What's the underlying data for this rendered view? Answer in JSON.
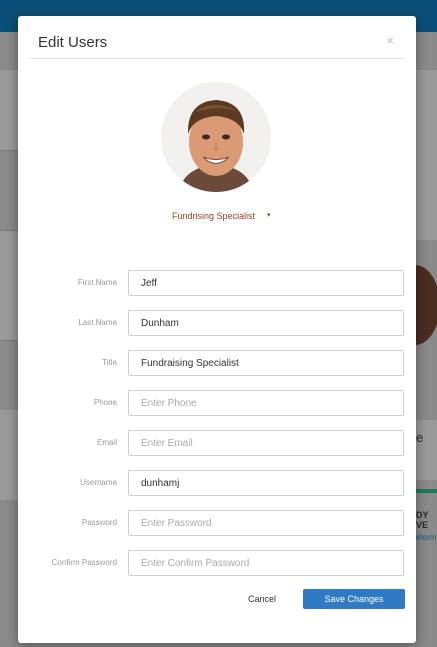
{
  "modal": {
    "title": "Edit Users",
    "close_label": "×",
    "role": {
      "selected": "Fundrising Specialist",
      "caret": "▾"
    }
  },
  "form": {
    "fields": [
      {
        "label": "First Name",
        "value": "Jeff",
        "placeholder": ""
      },
      {
        "label": "Last Name",
        "value": "Dunham",
        "placeholder": ""
      },
      {
        "label": "Title",
        "value": "Fundraising Specialist",
        "placeholder": ""
      },
      {
        "label": "Phone",
        "value": "",
        "placeholder": "Enter Phone"
      },
      {
        "label": "Email",
        "value": "",
        "placeholder": "Enter Email"
      },
      {
        "label": "Username",
        "value": "dunhamj",
        "placeholder": ""
      },
      {
        "label": "Password",
        "value": "",
        "placeholder": "Enter Password"
      },
      {
        "label": "Confirm Password",
        "value": "",
        "placeholder": "Enter Confirm Password"
      }
    ]
  },
  "actions": {
    "cancel_label": "Cancel",
    "save_label": "Save Changes"
  },
  "background": {
    "right_text_1": "DY VE",
    "right_text_2": "eterm",
    "right_text_3": "e"
  },
  "colors": {
    "accent": "#2f7ac4",
    "topbar": "#0b4f78",
    "role_text": "#a0401e",
    "success_bar": "#1c7a5a"
  }
}
